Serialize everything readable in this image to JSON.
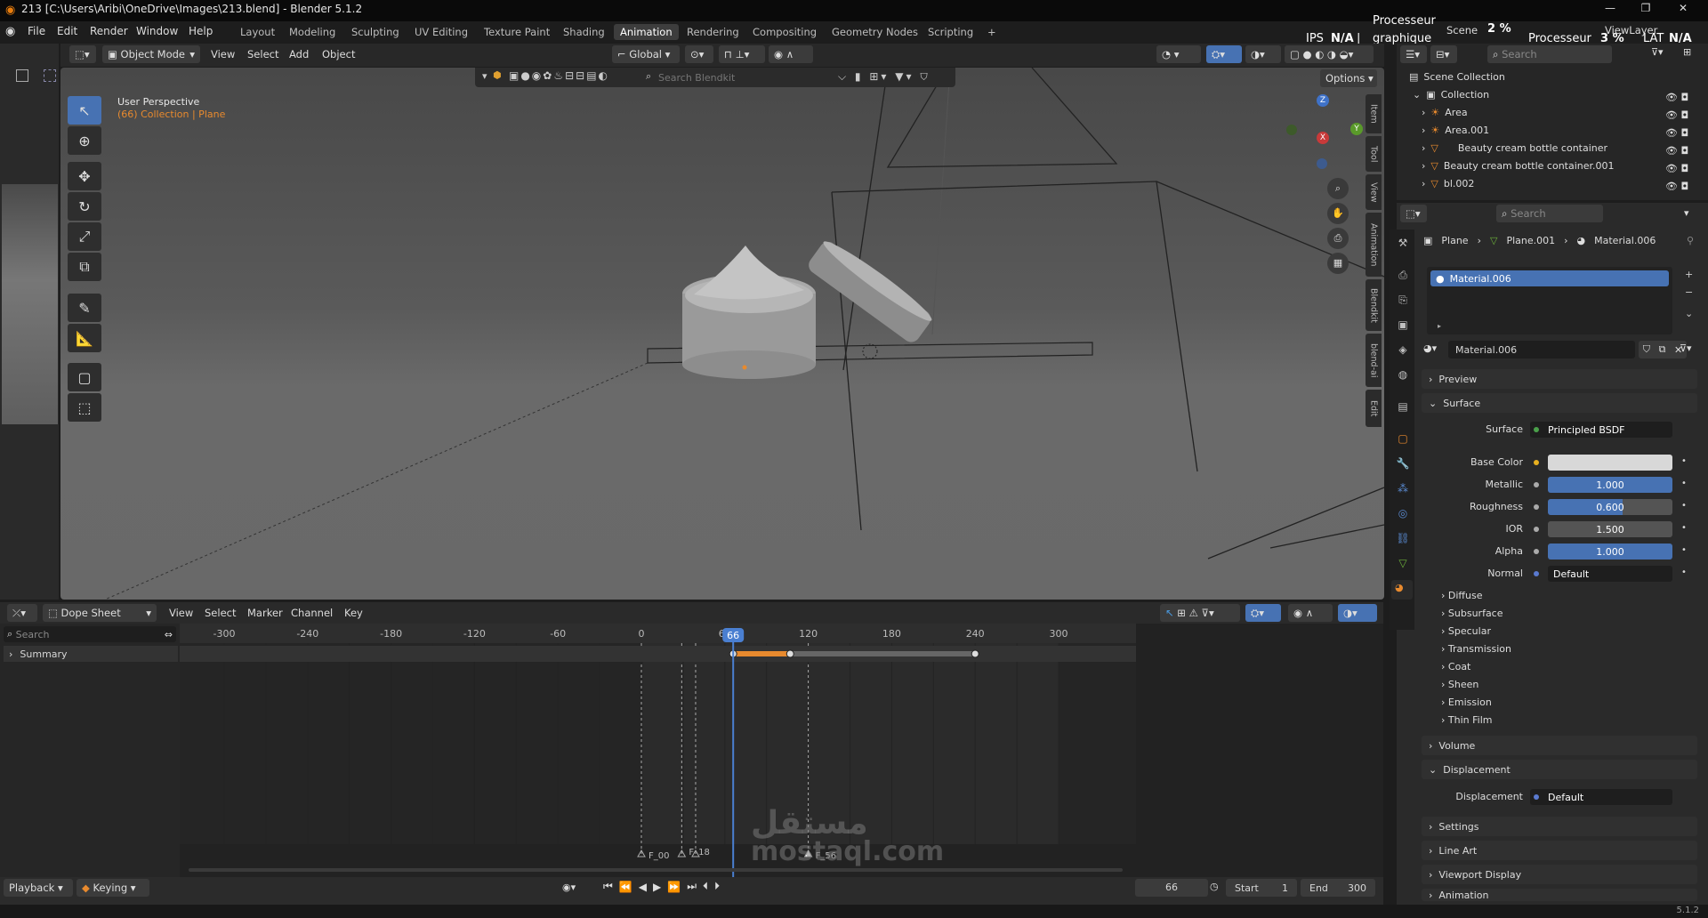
{
  "titlebar": {
    "title": "213 [C:\\Users\\Aribi\\OneDrive\\Images\\213.blend] - Blender 5.1.2",
    "minimize": "—",
    "maximize": "❐",
    "close": "✕"
  },
  "menu": [
    "File",
    "Edit",
    "Render",
    "Window",
    "Help"
  ],
  "workspaces": [
    "Layout",
    "Modeling",
    "Sculpting",
    "UV Editing",
    "Texture Paint",
    "Shading",
    "Animation",
    "Rendering",
    "Compositing",
    "Geometry Nodes",
    "Scripting",
    "+"
  ],
  "active_workspace": "Animation",
  "top_right": {
    "scene_label": "Scene",
    "view_layer": "ViewLayer",
    "gpu1": "Processeur",
    "gpu1b": "graphique",
    "pct1": "2 %",
    "fps": "IPS",
    "fps_val": "N/A",
    "gpu2": "Processeur",
    "pct2": "3 %",
    "lat": "LAT",
    "lat_val": "N/A"
  },
  "viewport": {
    "mode": "Object Mode",
    "menus": [
      "View",
      "Select",
      "Add",
      "Object"
    ],
    "transform": "Global",
    "search_placeholder": "Search Blendkit",
    "options": "Options",
    "perspective": "User Perspective",
    "collection": "(66) Collection | Plane",
    "gizmo": {
      "z": "Z",
      "y": "Y",
      "x": "X"
    },
    "side_tabs": [
      "Item",
      "Tool",
      "View",
      "Animation",
      "Blendkit",
      "blend-ai",
      "Edit"
    ]
  },
  "outliner": {
    "search": "Search",
    "items": [
      {
        "name": "Scene Collection"
      },
      {
        "name": "Collection"
      },
      {
        "name": "Area"
      },
      {
        "name": "Area.001"
      },
      {
        "name": "Beauty cream bottle container"
      },
      {
        "name": "Beauty cream bottle container.001"
      },
      {
        "name": "bl.002"
      }
    ]
  },
  "properties": {
    "search": "Search",
    "breadcrumb": [
      "Plane",
      "Plane.001",
      "Material.006"
    ],
    "slot": "Material.006",
    "material_name": "Material.006",
    "panels_top": [
      "Preview",
      "Surface"
    ],
    "surface": {
      "label": "Surface",
      "shader": "Principled BSDF"
    },
    "inputs": [
      {
        "label": "Base Color",
        "value": "",
        "color": "#d8d8d8"
      },
      {
        "label": "Metallic",
        "value": "1.000",
        "fill": 1.0
      },
      {
        "label": "Roughness",
        "value": "0.600",
        "fill": 0.6
      },
      {
        "label": "IOR",
        "value": "1.500",
        "fill": 0.0
      },
      {
        "label": "Alpha",
        "value": "1.000",
        "fill": 1.0
      },
      {
        "label": "Normal",
        "value": "Default",
        "fill": 0.0
      }
    ],
    "subpanels": [
      "Diffuse",
      "Subsurface",
      "Specular",
      "Transmission",
      "Coat",
      "Sheen",
      "Emission",
      "Thin Film"
    ],
    "panels_bottom": [
      "Volume",
      "Displacement"
    ],
    "displacement": {
      "label": "Displacement",
      "value": "Default"
    },
    "panels_end": [
      "Settings",
      "Line Art",
      "Viewport Display",
      "Animation"
    ]
  },
  "dopesheet": {
    "mode": "Dope Sheet",
    "menus": [
      "View",
      "Select",
      "Marker",
      "Channel",
      "Key"
    ],
    "search": "Search",
    "summary": "Summary",
    "ticks": [
      "-300",
      "-240",
      "-180",
      "-120",
      "-60",
      "0",
      "60",
      "120",
      "180",
      "240",
      "300"
    ],
    "current_frame": "66",
    "markers": [
      "F_00",
      "F_18",
      "F_56"
    ]
  },
  "playback": {
    "playback": "Playback",
    "keying": "Keying",
    "frame": "66",
    "start_label": "Start",
    "start": "1",
    "end_label": "End",
    "end": "300"
  },
  "status": {
    "version": "5.1.2"
  },
  "watermark": {
    "ar": "مستقل",
    "en": "mostaql.com"
  },
  "colors": {
    "accent": "#4772b3",
    "orange": "#e88a2e",
    "timeline_cursor": "#4a7fd1"
  }
}
